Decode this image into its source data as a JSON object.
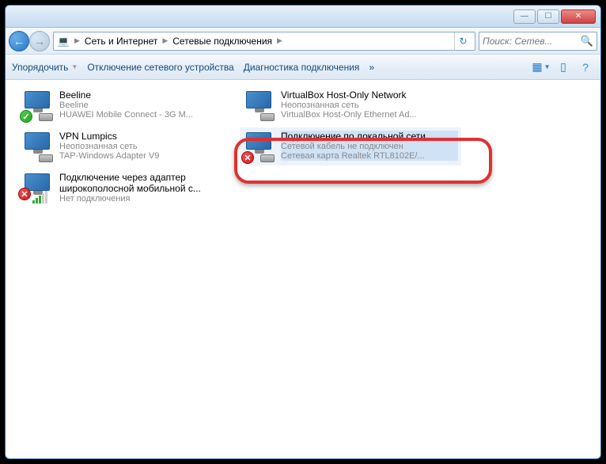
{
  "titlebar": {
    "min": "—",
    "max": "☐",
    "close": "✕"
  },
  "address": {
    "segments": [
      "Сеть и Интернет",
      "Сетевые подключения"
    ]
  },
  "search": {
    "placeholder": "Поиск: Сетев..."
  },
  "toolbar": {
    "organize": "Упорядочить",
    "disable": "Отключение сетевого устройства",
    "diagnose": "Диагностика подключения",
    "more": "»"
  },
  "connections": [
    {
      "name": "Beeline",
      "status": "Beeline",
      "device": "HUAWEI Mobile Connect - 3G M...",
      "badge": "ok"
    },
    {
      "name": "VirtualBox Host-Only Network",
      "status": "Неопознанная сеть",
      "device": "VirtualBox Host-Only Ethernet Ad...",
      "badge": "none"
    },
    {
      "name": "VPN Lumpics",
      "status": "Неопознанная сеть",
      "device": "TAP-Windows Adapter V9",
      "badge": "none"
    },
    {
      "name": "Подключение по локальной сети",
      "status": "Сетевой кабель не подключен",
      "device": "Сетевая карта Realtek RTL8102E/...",
      "badge": "err",
      "selected": true
    },
    {
      "name": "Подключение через адаптер широкополосной мобильной с...",
      "status": "Нет подключения",
      "device": "",
      "badge": "bars"
    }
  ]
}
